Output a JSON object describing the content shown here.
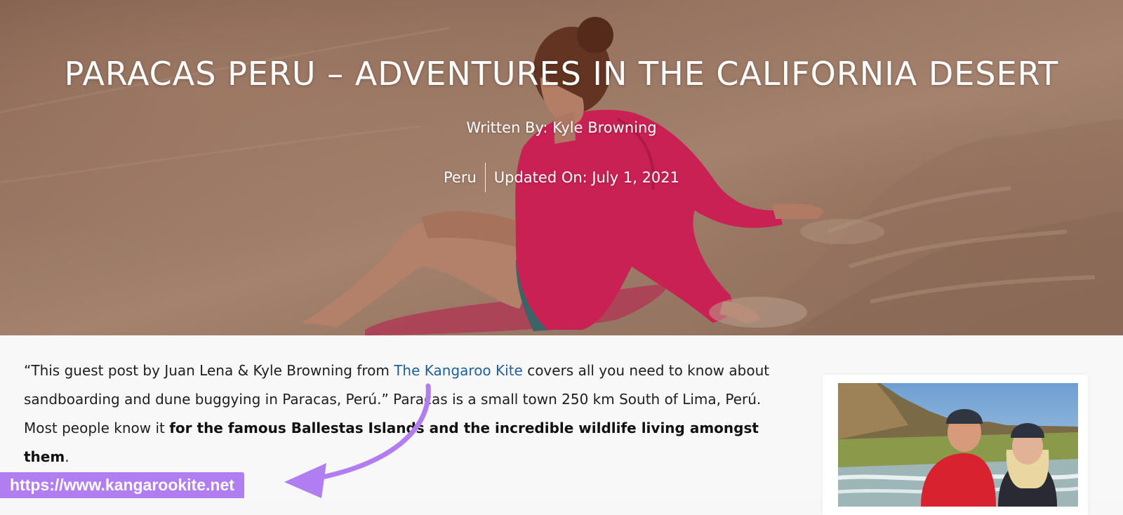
{
  "hero": {
    "title": "PARACAS PERU – ADVENTURES IN THE CALIFORNIA DESERT",
    "byline": "Written By: Kyle Browning",
    "category": "Peru",
    "updated": "Updated On: July 1, 2021"
  },
  "article": {
    "intro_1": "“This guest post by Juan Lena & Kyle Browning from ",
    "link_text": "The Kangaroo Kite",
    "intro_2": " covers all you need to know about sandboarding and dune buggying in Paracas, Perú.” Paracas is a small town 250 km South of Lima, Perú. Most people know it ",
    "bold_text": "for the famous Ballestas Islands and the incredible wildlife living amongst them",
    "intro_end": "."
  },
  "annotation": {
    "url": "https://www.kangarookite.net",
    "color": "#b07ef0"
  },
  "colors": {
    "link": "#1f5f9a",
    "jacket": "#e0245e"
  }
}
